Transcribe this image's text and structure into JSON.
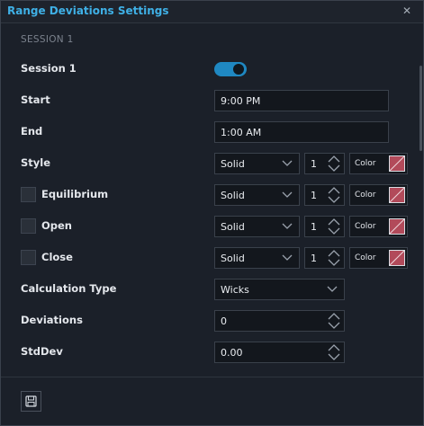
{
  "dialog": {
    "title": "Range Deviations Settings",
    "close_icon": "close-icon"
  },
  "section": {
    "title": "SESSION 1"
  },
  "session_toggle": {
    "label": "Session 1",
    "enabled": true
  },
  "start": {
    "label": "Start",
    "value": "9:00 PM"
  },
  "end": {
    "label": "End",
    "value": "1:00 AM"
  },
  "style_rows": [
    {
      "label": "Style",
      "has_checkbox": false,
      "style": "Solid",
      "width": "1",
      "color_label": "Color"
    },
    {
      "label": "Equilibrium",
      "has_checkbox": true,
      "checked": false,
      "style": "Solid",
      "width": "1",
      "color_label": "Color"
    },
    {
      "label": "Open",
      "has_checkbox": true,
      "checked": false,
      "style": "Solid",
      "width": "1",
      "color_label": "Color"
    },
    {
      "label": "Close",
      "has_checkbox": true,
      "checked": false,
      "style": "Solid",
      "width": "1",
      "color_label": "Color"
    }
  ],
  "calculation_type": {
    "label": "Calculation Type",
    "value": "Wicks"
  },
  "deviations": {
    "label": "Deviations",
    "value": "0"
  },
  "stddev": {
    "label": "StdDev",
    "value": "0.00"
  },
  "footer": {
    "save_icon": "save-icon"
  },
  "colors": {
    "accent": "#3fb0e6",
    "toggle": "#1f88c2",
    "swatch": "#b24a5a"
  }
}
